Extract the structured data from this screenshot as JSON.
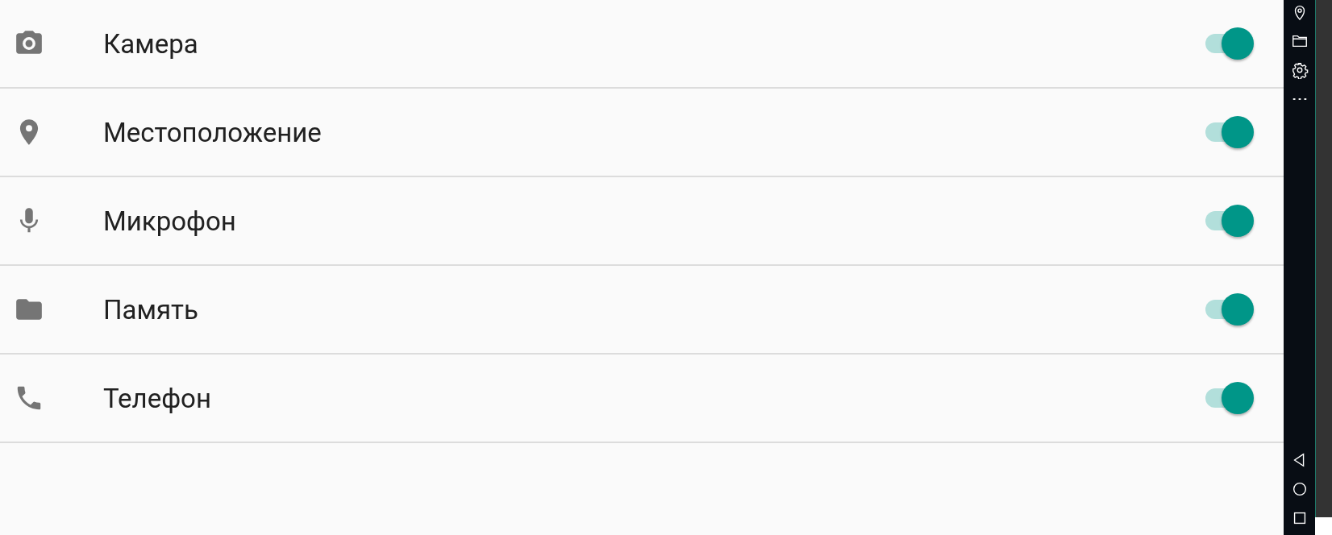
{
  "permissions": [
    {
      "kind": "camera",
      "label": "Камера",
      "on": true
    },
    {
      "kind": "location",
      "label": "Местоположение",
      "on": true
    },
    {
      "kind": "microphone",
      "label": "Микрофон",
      "on": true
    },
    {
      "kind": "storage",
      "label": "Память",
      "on": true
    },
    {
      "kind": "phone",
      "label": "Телефон",
      "on": true
    }
  ]
}
